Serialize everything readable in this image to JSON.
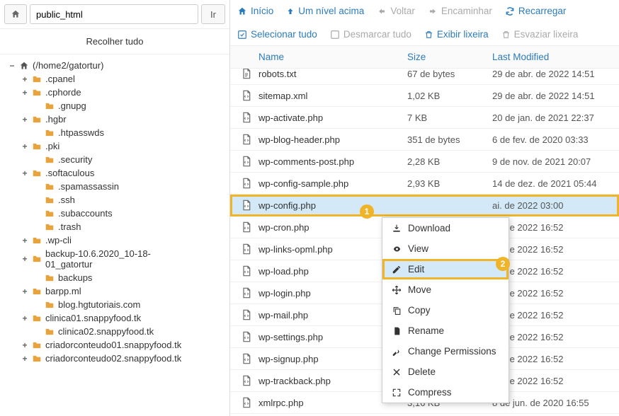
{
  "pathbar": {
    "value": "public_html",
    "go": "Ir"
  },
  "collapse_all": "Recolher tudo",
  "tree": [
    {
      "depth": 0,
      "toggle": "−",
      "icon": "home",
      "label": "(/home2/gatortur)"
    },
    {
      "depth": 1,
      "toggle": "+",
      "icon": "folder",
      "label": ".cpanel"
    },
    {
      "depth": 1,
      "toggle": "+",
      "icon": "folder",
      "label": ".cphorde"
    },
    {
      "depth": 2,
      "toggle": "",
      "icon": "folder",
      "label": ".gnupg"
    },
    {
      "depth": 1,
      "toggle": "+",
      "icon": "folder",
      "label": ".hgbr"
    },
    {
      "depth": 2,
      "toggle": "",
      "icon": "folder",
      "label": ".htpasswds"
    },
    {
      "depth": 1,
      "toggle": "+",
      "icon": "folder",
      "label": ".pki"
    },
    {
      "depth": 2,
      "toggle": "",
      "icon": "folder",
      "label": ".security"
    },
    {
      "depth": 1,
      "toggle": "+",
      "icon": "folder",
      "label": ".softaculous"
    },
    {
      "depth": 2,
      "toggle": "",
      "icon": "folder",
      "label": ".spamassassin"
    },
    {
      "depth": 2,
      "toggle": "",
      "icon": "folder",
      "label": ".ssh"
    },
    {
      "depth": 2,
      "toggle": "",
      "icon": "folder",
      "label": ".subaccounts"
    },
    {
      "depth": 2,
      "toggle": "",
      "icon": "folder",
      "label": ".trash"
    },
    {
      "depth": 1,
      "toggle": "+",
      "icon": "folder",
      "label": ".wp-cli"
    },
    {
      "depth": 1,
      "toggle": "+",
      "icon": "folder",
      "label": "backup-10.6.2020_10-18-01_gatortur",
      "wrap": true
    },
    {
      "depth": 2,
      "toggle": "",
      "icon": "folder",
      "label": "backups"
    },
    {
      "depth": 1,
      "toggle": "+",
      "icon": "folder",
      "label": "barpp.ml"
    },
    {
      "depth": 2,
      "toggle": "",
      "icon": "folder",
      "label": "blog.hgtutoriais.com"
    },
    {
      "depth": 1,
      "toggle": "+",
      "icon": "folder",
      "label": "clinica01.snappyfood.tk"
    },
    {
      "depth": 2,
      "toggle": "",
      "icon": "folder",
      "label": "clinica02.snappyfood.tk"
    },
    {
      "depth": 1,
      "toggle": "+",
      "icon": "folder",
      "label": "criadorconteudo01.snappyfood.tk"
    },
    {
      "depth": 1,
      "toggle": "+",
      "icon": "folder",
      "label": "criadorconteudo02.snappyfood.tk"
    }
  ],
  "toolbar": {
    "home": "Início",
    "up": "Um nível acima",
    "back": "Voltar",
    "forward": "Encaminhar",
    "reload": "Recarregar",
    "select_all": "Selecionar tudo",
    "deselect_all": "Desmarcar tudo",
    "show_trash": "Exibir lixeira",
    "empty_trash": "Esvaziar lixeira"
  },
  "columns": {
    "name": "Name",
    "size": "Size",
    "modified": "Last Modified"
  },
  "files": [
    {
      "icon": "txt",
      "name": "robots.txt",
      "size": "67 de bytes",
      "mod": "29 de abr. de 2022 14:51",
      "cut": true
    },
    {
      "icon": "code",
      "name": "sitemap.xml",
      "size": "1,02 KB",
      "mod": "29 de abr. de 2022 14:51"
    },
    {
      "icon": "code",
      "name": "wp-activate.php",
      "size": "7 KB",
      "mod": "20 de jan. de 2021 22:37"
    },
    {
      "icon": "code",
      "name": "wp-blog-header.php",
      "size": "351 de bytes",
      "mod": "6 de fev. de 2020 03:33"
    },
    {
      "icon": "code",
      "name": "wp-comments-post.php",
      "size": "2,28 KB",
      "mod": "9 de nov. de 2021 20:07"
    },
    {
      "icon": "code",
      "name": "wp-config-sample.php",
      "size": "2,93 KB",
      "mod": "14 de dez. de 2021 05:44"
    },
    {
      "icon": "code",
      "name": "wp-config.php",
      "size": "",
      "mod": "ai. de 2022 03:00",
      "selected": true,
      "highlight": true
    },
    {
      "icon": "code",
      "name": "wp-cron.php",
      "size": "",
      "mod": "ai. de 2022 16:52"
    },
    {
      "icon": "code",
      "name": "wp-links-opml.php",
      "size": "",
      "mod": "ai. de 2022 16:52"
    },
    {
      "icon": "code",
      "name": "wp-load.php",
      "size": "",
      "mod": "ai. de 2022 16:52"
    },
    {
      "icon": "code",
      "name": "wp-login.php",
      "size": "",
      "mod": "ai. de 2022 16:52"
    },
    {
      "icon": "code",
      "name": "wp-mail.php",
      "size": "",
      "mod": "ai. de 2022 16:52"
    },
    {
      "icon": "code",
      "name": "wp-settings.php",
      "size": "",
      "mod": "ai. de 2022 16:52"
    },
    {
      "icon": "code",
      "name": "wp-signup.php",
      "size": "",
      "mod": "ai. de 2022 16:52"
    },
    {
      "icon": "code",
      "name": "wp-trackback.php",
      "size": "",
      "mod": "ai. de 2022 16:52"
    },
    {
      "icon": "code",
      "name": "xmlrpc.php",
      "size": "3,16 KB",
      "mod": "8 de jun. de 2020 16:55"
    }
  ],
  "context_menu": [
    {
      "icon": "download",
      "label": "Download"
    },
    {
      "icon": "eye",
      "label": "View"
    },
    {
      "icon": "edit",
      "label": "Edit",
      "highlight": true
    },
    {
      "icon": "move",
      "label": "Move"
    },
    {
      "icon": "copy",
      "label": "Copy"
    },
    {
      "icon": "rename",
      "label": "Rename"
    },
    {
      "icon": "key",
      "label": "Change Permissions"
    },
    {
      "icon": "delete",
      "label": "Delete"
    },
    {
      "icon": "compress",
      "label": "Compress"
    }
  ],
  "badges": {
    "b1": "1",
    "b2": "2"
  }
}
